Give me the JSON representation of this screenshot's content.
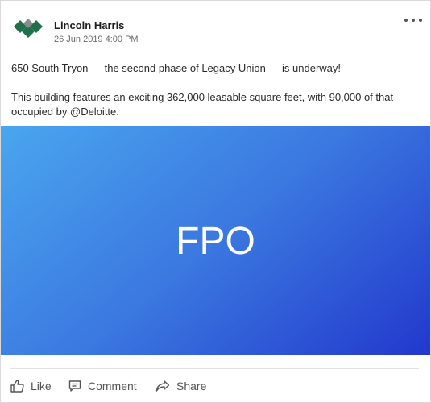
{
  "post": {
    "author": "Lincoln Harris",
    "timestamp": "26 Jun 2019 4:00 PM",
    "text_line1": "650 South Tryon — the second phase of Legacy Union — is underway!",
    "text_line2": "This building features an exciting 362,000 leasable square feet, with 90,000 of that occupied by @Deloitte.",
    "media_label": "FPO"
  },
  "actions": {
    "like_label": "Like",
    "comment_label": "Comment",
    "share_label": "Share"
  },
  "icons": {
    "logo": "lincoln-harris-logo",
    "more": "ellipsis-icon",
    "like": "thumbs-up-icon",
    "comment": "comment-icon",
    "share": "share-arrow-icon"
  },
  "colors": {
    "logo_green": "#1f6f4a",
    "logo_gray": "#8a8a8a",
    "media_gradient_start": "#4aa6ef",
    "media_gradient_end": "#2238cc"
  }
}
